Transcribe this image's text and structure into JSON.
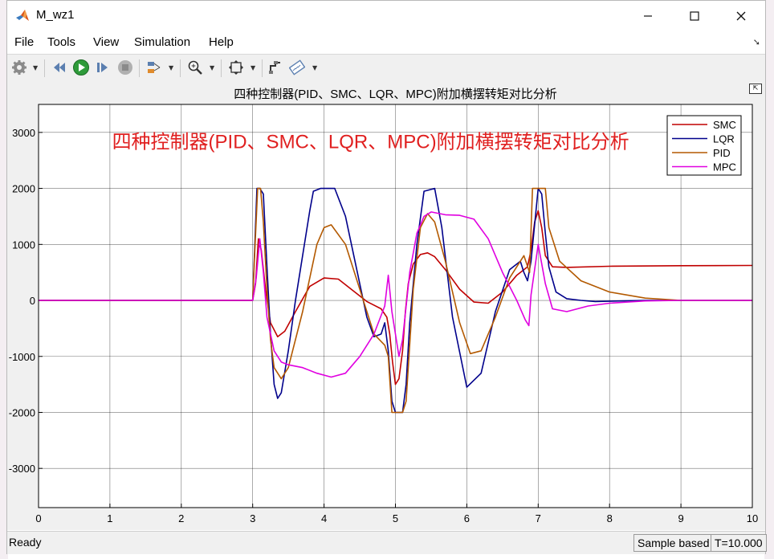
{
  "window": {
    "title": "M_wz1",
    "controls": {
      "minimize": "—",
      "maximize": "☐",
      "close": "✕"
    }
  },
  "menu": {
    "items": [
      "File",
      "Tools",
      "View",
      "Simulation",
      "Help"
    ]
  },
  "toolbar": {
    "icons": [
      "gear-icon",
      "step-back-icon",
      "run-icon",
      "step-forward-icon",
      "stop-icon",
      "signal-select-icon",
      "zoom-icon",
      "fit-view-icon",
      "cursor-measure-icon",
      "style-brush-icon"
    ]
  },
  "status": {
    "left": "Ready",
    "mode": "Sample based",
    "time": "T=10.000"
  },
  "chart_data": {
    "type": "line",
    "title": "四种控制器(PID、SMC、LQR、MPC)附加横摆转矩对比分析",
    "overlay_title": "四种控制器(PID、SMC、LQR、MPC)附加横摆转矩对比分析",
    "xlim": [
      0,
      10
    ],
    "ylim": [
      -3700,
      3500
    ],
    "xticks": [
      0,
      1,
      2,
      3,
      4,
      5,
      6,
      7,
      8,
      9,
      10
    ],
    "yticks": [
      -3000,
      -2000,
      -1000,
      0,
      1000,
      2000,
      3000
    ],
    "grid": true,
    "legend_position": "top-right",
    "colors": {
      "background": "#ffffff",
      "axes_bg": "#ffffff",
      "grid": "#000000"
    },
    "series": [
      {
        "name": "SMC",
        "color": "#c00000",
        "x": [
          0,
          3.0,
          3.04,
          3.08,
          3.12,
          3.18,
          3.25,
          3.35,
          3.45,
          3.6,
          3.8,
          4.0,
          4.2,
          4.4,
          4.6,
          4.8,
          4.88,
          4.92,
          4.96,
          5.0,
          5.05,
          5.1,
          5.14,
          5.18,
          5.25,
          5.35,
          5.45,
          5.55,
          5.7,
          5.9,
          6.1,
          6.3,
          6.5,
          6.7,
          6.85,
          6.9,
          6.95,
          7.0,
          7.05,
          7.1,
          7.2,
          7.4,
          8.0,
          9.0,
          10.0
        ],
        "y": [
          0,
          0,
          300,
          1100,
          900,
          200,
          -400,
          -650,
          -550,
          -200,
          250,
          400,
          380,
          180,
          -20,
          -150,
          -300,
          -600,
          -1100,
          -1500,
          -1400,
          -900,
          -200,
          300,
          650,
          820,
          850,
          780,
          550,
          200,
          -30,
          -50,
          150,
          450,
          600,
          900,
          1400,
          1600,
          1300,
          800,
          600,
          590,
          610,
          620,
          625
        ]
      },
      {
        "name": "LQR",
        "color": "#00008b",
        "x": [
          0,
          3.0,
          3.03,
          3.06,
          3.1,
          3.15,
          3.2,
          3.25,
          3.3,
          3.35,
          3.4,
          3.5,
          3.6,
          3.7,
          3.8,
          3.85,
          3.95,
          4.15,
          4.3,
          4.45,
          4.6,
          4.7,
          4.8,
          4.85,
          4.9,
          4.95,
          5.0,
          5.1,
          5.15,
          5.2,
          5.3,
          5.4,
          5.55,
          5.65,
          5.8,
          6.0,
          6.2,
          6.4,
          6.6,
          6.75,
          6.8,
          6.85,
          6.9,
          7.0,
          7.05,
          7.1,
          7.15,
          7.25,
          7.4,
          7.6,
          7.8,
          8.5,
          9.0,
          10.0
        ],
        "y": [
          0,
          0,
          1000,
          2000,
          2000,
          1900,
          600,
          -600,
          -1500,
          -1750,
          -1650,
          -900,
          0,
          800,
          1600,
          1950,
          2000,
          2000,
          1500,
          600,
          -300,
          -650,
          -600,
          -400,
          -900,
          -1800,
          -2000,
          -2000,
          -1500,
          -400,
          1000,
          1950,
          2000,
          1300,
          -300,
          -1550,
          -1300,
          -200,
          550,
          700,
          500,
          350,
          700,
          2000,
          1900,
          1200,
          600,
          150,
          30,
          0,
          -20,
          0,
          0,
          0
        ]
      },
      {
        "name": "PID",
        "color": "#b35900",
        "x": [
          0,
          3.0,
          3.03,
          3.07,
          3.11,
          3.15,
          3.2,
          3.25,
          3.3,
          3.4,
          3.5,
          3.7,
          3.9,
          4.0,
          4.1,
          4.3,
          4.5,
          4.7,
          4.85,
          4.9,
          4.95,
          5.0,
          5.1,
          5.15,
          5.25,
          5.35,
          5.45,
          5.55,
          5.7,
          5.9,
          6.05,
          6.2,
          6.4,
          6.6,
          6.8,
          6.88,
          6.92,
          7.0,
          7.1,
          7.15,
          7.3,
          7.6,
          8.0,
          8.5,
          9.0,
          10.0
        ],
        "y": [
          0,
          0,
          900,
          2000,
          2000,
          1400,
          200,
          -700,
          -1200,
          -1400,
          -1200,
          -200,
          1000,
          1300,
          1350,
          1000,
          200,
          -600,
          -800,
          -1000,
          -2000,
          -2000,
          -2000,
          -1800,
          200,
          1300,
          1550,
          1400,
          700,
          -400,
          -950,
          -900,
          -300,
          400,
          800,
          500,
          2000,
          2000,
          2000,
          1300,
          700,
          350,
          150,
          40,
          0,
          0
        ]
      },
      {
        "name": "MPC",
        "color": "#e000e0",
        "x": [
          0,
          3.0,
          3.05,
          3.1,
          3.15,
          3.2,
          3.3,
          3.4,
          3.5,
          3.7,
          3.9,
          4.1,
          4.3,
          4.5,
          4.7,
          4.85,
          4.9,
          4.95,
          5.05,
          5.1,
          5.2,
          5.3,
          5.4,
          5.5,
          5.7,
          5.9,
          6.1,
          6.3,
          6.5,
          6.7,
          6.82,
          6.87,
          6.9,
          7.0,
          7.1,
          7.2,
          7.4,
          7.7,
          8.0,
          8.5,
          9.0,
          10.0
        ],
        "y": [
          0,
          0,
          400,
          1100,
          500,
          -300,
          -900,
          -1100,
          -1150,
          -1200,
          -1300,
          -1370,
          -1300,
          -1000,
          -600,
          -100,
          450,
          -200,
          -1000,
          -700,
          500,
          1200,
          1500,
          1580,
          1530,
          1520,
          1450,
          1100,
          500,
          0,
          -350,
          -450,
          100,
          1000,
          300,
          -150,
          -200,
          -100,
          -50,
          -10,
          0,
          0
        ]
      }
    ]
  }
}
